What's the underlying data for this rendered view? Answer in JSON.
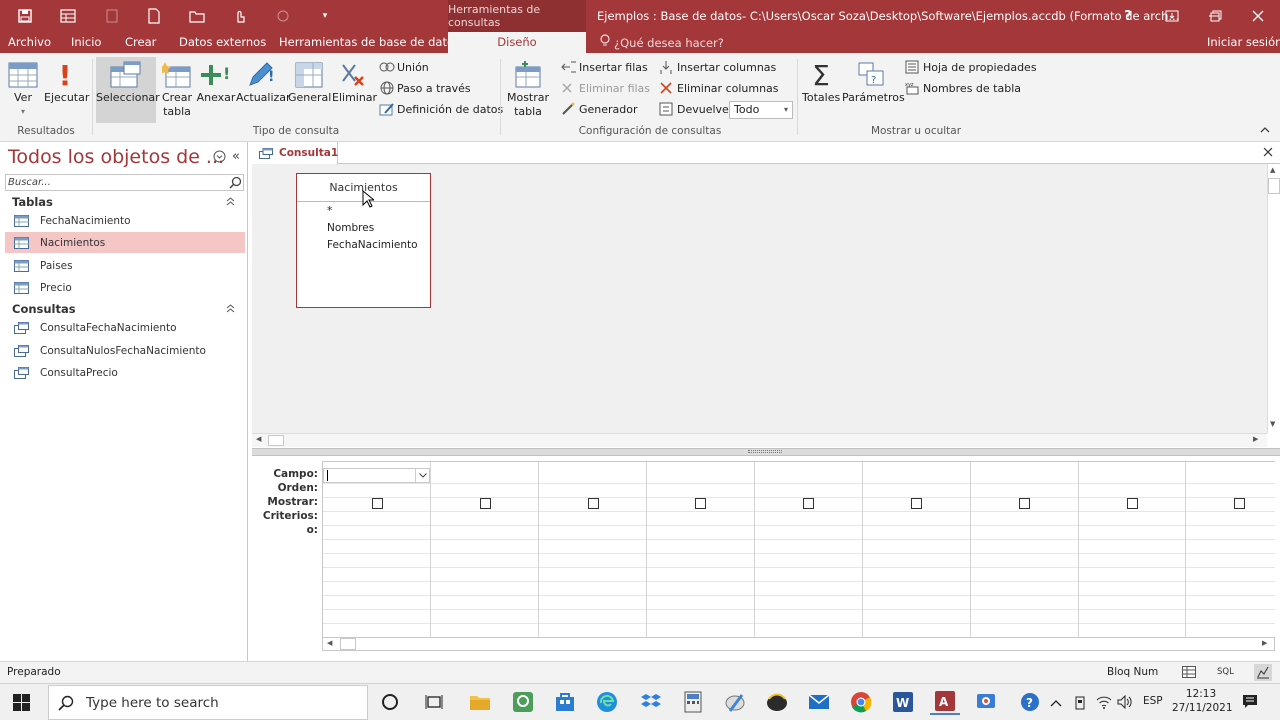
{
  "titlebar": {
    "context_tab": "Herramientas de consultas",
    "title": "Ejemplos : Base de datos- C:\\Users\\Oscar Soza\\Desktop\\Software\\Ejemplos.accdb (Formato de arch...",
    "help": "?",
    "accent": "#a4373a"
  },
  "tabs": {
    "archivo": "Archivo",
    "inicio": "Inicio",
    "crear": "Crear",
    "datos_externos": "Datos externos",
    "herramientas": "Herramientas de base de datos",
    "diseno": "Diseño",
    "tell_me": "¿Qué desea hacer?",
    "signin": "Iniciar sesión"
  },
  "ribbon": {
    "resultados": {
      "label": "Resultados",
      "ver": "Ver",
      "ejecutar": "Ejecutar"
    },
    "tipo": {
      "label": "Tipo de consulta",
      "seleccionar": "Seleccionar",
      "crear_tabla_1": "Crear",
      "crear_tabla_2": "tabla",
      "anexar": "Anexar",
      "actualizar": "Actualizar",
      "general": "General",
      "eliminar": "Eliminar",
      "union": "Unión",
      "paso": "Paso a través",
      "definicion": "Definición de datos"
    },
    "config": {
      "label": "Configuración de consultas",
      "mostrar_tabla_1": "Mostrar",
      "mostrar_tabla_2": "tabla",
      "insertar_filas": "Insertar filas",
      "eliminar_filas": "Eliminar filas",
      "generador": "Generador",
      "insertar_columnas": "Insertar columnas",
      "eliminar_columnas": "Eliminar columnas",
      "devuelve": "Devuelve:",
      "devuelve_value": "Todo"
    },
    "mostrar": {
      "label": "Mostrar u ocultar",
      "totales": "Totales",
      "parametros": "Parámetros",
      "hoja": "Hoja de propiedades",
      "nombres": "Nombres de tabla"
    }
  },
  "nav": {
    "title": "Todos los objetos de ...",
    "search_placeholder": "Buscar...",
    "tablas_header": "Tablas",
    "tablas": [
      "FechaNacimiento",
      "Nacimientos",
      "Paises",
      "Precio"
    ],
    "consultas_header": "Consultas",
    "consultas": [
      "ConsultaFechaNacimiento",
      "ConsultaNulosFechaNacimiento",
      "ConsultaPrecio"
    ]
  },
  "document": {
    "tab": "Consulta1",
    "table_name": "Nacimientos",
    "fields": [
      "*",
      "Nombres",
      "FechaNacimiento"
    ]
  },
  "grid": {
    "rows": [
      "Campo:",
      "Orden:",
      "Mostrar:",
      "Criterios:",
      "o:"
    ]
  },
  "status": {
    "left": "Preparado",
    "bloq": "Bloq Num",
    "sql": "SQL"
  },
  "taskbar": {
    "search": "Type here to search",
    "lang": "ESP",
    "time": "12:13",
    "date": "27/11/2021"
  }
}
